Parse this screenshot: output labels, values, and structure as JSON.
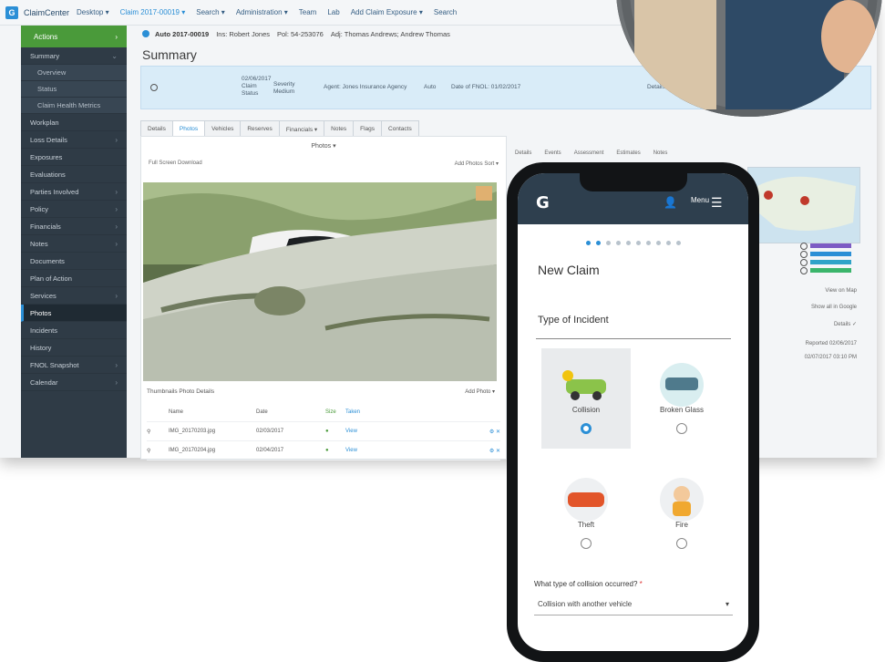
{
  "app": {
    "brand": "ClaimCenter",
    "menus": [
      "Desktop ▾",
      "Claim 2017-00019 ▾",
      "Search ▾",
      "Administration ▾",
      "Team",
      "Lab",
      "Add Claim Exposure ▾",
      "Search"
    ]
  },
  "sidebar": {
    "home": "Actions",
    "items": [
      {
        "label": "Summary",
        "type": "item",
        "chev": "⌄"
      },
      {
        "label": "Overview",
        "type": "sub",
        "chev": ""
      },
      {
        "label": "Status",
        "type": "sub",
        "chev": ""
      },
      {
        "label": "Claim Health Metrics",
        "type": "sub",
        "chev": ""
      },
      {
        "label": "Workplan",
        "type": "item",
        "chev": ""
      },
      {
        "label": "Loss Details",
        "type": "item",
        "chev": "›"
      },
      {
        "label": "Exposures",
        "type": "item",
        "chev": ""
      },
      {
        "label": "Evaluations",
        "type": "item",
        "chev": ""
      },
      {
        "label": "Parties Involved",
        "type": "item",
        "chev": "›"
      },
      {
        "label": "Policy",
        "type": "item",
        "chev": "›"
      },
      {
        "label": "Financials",
        "type": "item",
        "chev": "›"
      },
      {
        "label": "Notes",
        "type": "item",
        "chev": "›"
      },
      {
        "label": "Documents",
        "type": "item",
        "chev": ""
      },
      {
        "label": "Plan of Action",
        "type": "item",
        "chev": ""
      },
      {
        "label": "Services",
        "type": "item",
        "chev": "›"
      },
      {
        "label": "Photos",
        "type": "item",
        "chev": "",
        "active": true
      },
      {
        "label": "Incidents",
        "type": "item",
        "chev": ""
      },
      {
        "label": "History",
        "type": "item",
        "chev": ""
      },
      {
        "label": "FNOL Snapshot",
        "type": "item",
        "chev": "›"
      },
      {
        "label": "Calendar",
        "type": "item",
        "chev": "›"
      }
    ]
  },
  "breadcrumb": {
    "claim": "Auto 2017-00019",
    "insured": "Ins: Robert Jones",
    "policy": "Pol: 54-253076",
    "loss": "Adj: Thomas Andrews; Andrew Thomas"
  },
  "page_title": "Summary",
  "infobar": {
    "fields": [
      "02/06/2017 Claim Status",
      "Severity Medium",
      "Agent: Jones Insurance Agency",
      "Auto",
      "Date of FNOL: 01/02/2017",
      "Details"
    ]
  },
  "tabs": [
    "Details",
    "Photos",
    "Vehicles",
    "Reserves",
    "Financials ▾",
    "Notes",
    "Flags",
    "Contacts"
  ],
  "photo_panel": {
    "header": "Photos ▾",
    "tool_left": "Full Screen    Download",
    "tool_right": "Add Photos    Sort ▾"
  },
  "grid": {
    "tabs": "Thumbnails   Photo Details",
    "right": "Add Photo ▾",
    "headers": [
      "Name",
      "Date",
      "Size",
      "Taken"
    ],
    "rows": [
      {
        "name": "IMG_20170203.jpg",
        "date": "02/03/2017",
        "status": "●",
        "view": "View"
      },
      {
        "name": "IMG_20170204.jpg",
        "date": "02/04/2017",
        "status": "●",
        "view": "View"
      }
    ]
  },
  "right_panel": {
    "tabs": [
      "Details",
      "Events",
      "Assessment",
      "Estimates",
      "Notes"
    ],
    "texts": [
      "View on Map",
      "Show all in Google",
      "Details ✓",
      "Reported 02/06/2017",
      "02/07/2017 03:10 PM"
    ],
    "legend_colors": [
      "#7c5bc4",
      "#2b8fd6",
      "#2fa3c8",
      "#3bb56b"
    ]
  },
  "phone": {
    "menu_label": "Menu",
    "title": "New Claim",
    "section": "Type of Incident",
    "options": [
      {
        "label": "Collision",
        "selected": true
      },
      {
        "label": "Broken Glass",
        "selected": false
      },
      {
        "label": "Theft",
        "selected": false
      },
      {
        "label": "Fire",
        "selected": false
      }
    ],
    "question": "What type of collision occurred?",
    "required": "*",
    "select_value": "Collision with another vehicle"
  }
}
